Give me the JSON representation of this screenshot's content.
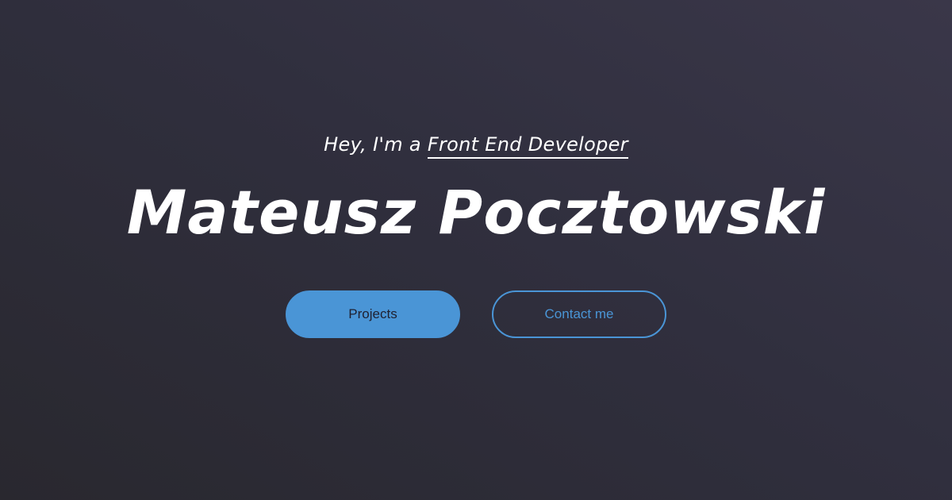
{
  "hero": {
    "greeting": "Hey, I'm a",
    "role": "Front End Developer",
    "name": "Mateusz Pocztowski"
  },
  "buttons": {
    "projects_label": "Projects",
    "contact_label": "Contact me"
  },
  "colors": {
    "accent": "#4a95d6",
    "background_top": "#3a3749",
    "background_bottom": "#29282f",
    "text": "#ffffff"
  }
}
